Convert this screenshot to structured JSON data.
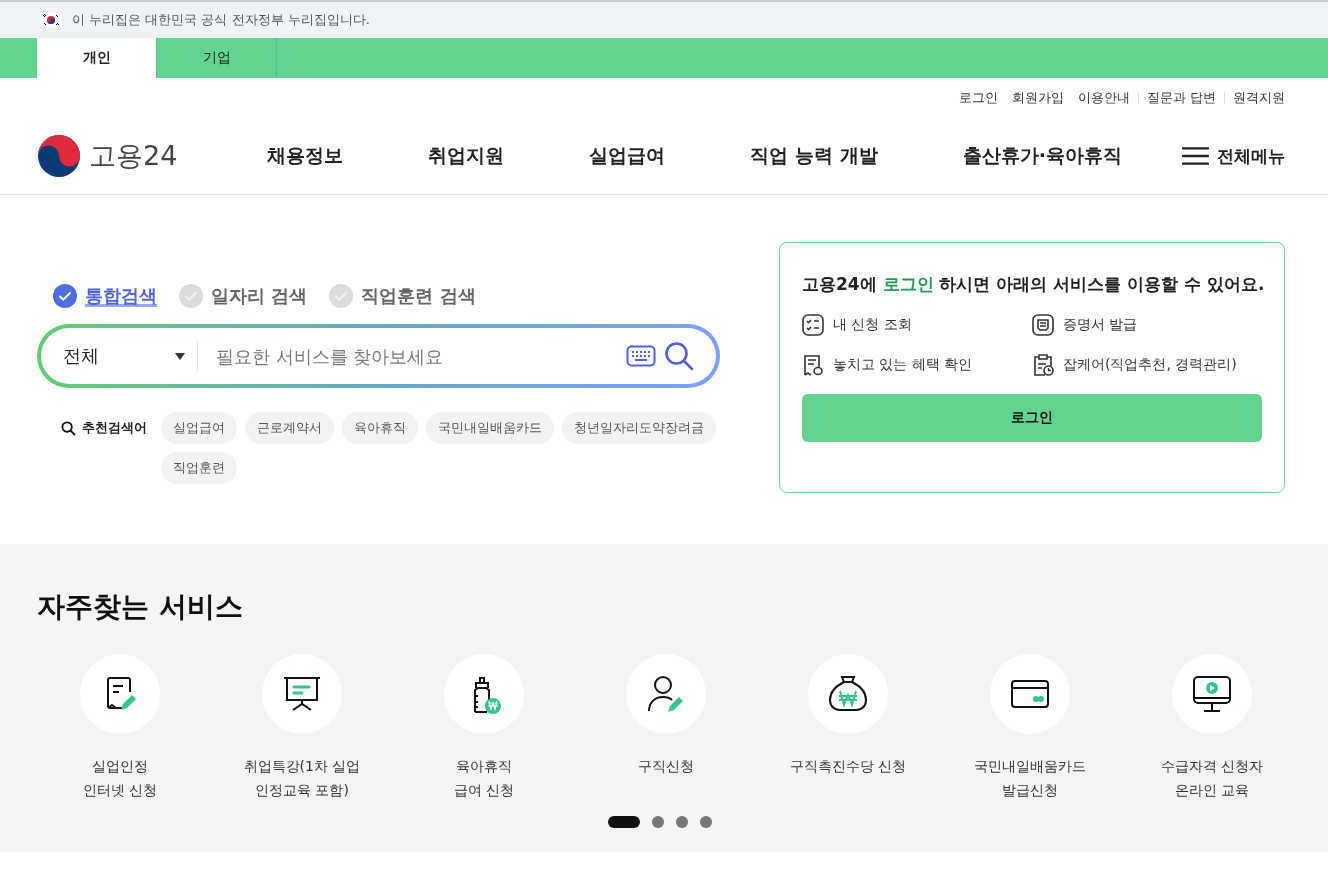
{
  "gov_banner": {
    "text": "이 누리집은 대한민국 공식 전자정부 누리집입니다."
  },
  "audience_tabs": [
    {
      "label": "개인",
      "selected": true
    },
    {
      "label": "기업",
      "selected": false
    }
  ],
  "utility_links": [
    "로그인",
    "회원가입",
    "이용안내",
    "질문과 답변",
    "원격지원"
  ],
  "logo": {
    "text": "고용24"
  },
  "main_nav": [
    "채용정보",
    "취업지원",
    "실업급여",
    "직업 능력 개발",
    "출산휴가·육아휴직"
  ],
  "all_menu": {
    "label": "전체메뉴"
  },
  "search_tabs": [
    {
      "label": "통합검색",
      "selected": true
    },
    {
      "label": "일자리 검색",
      "selected": false
    },
    {
      "label": "직업훈련 검색",
      "selected": false
    }
  ],
  "search": {
    "scope": "전체",
    "placeholder": "필요한 서비스를 찾아보세요"
  },
  "recommended": {
    "label": "추천검색어",
    "keywords": [
      "실업급여",
      "근로계약서",
      "육아휴직",
      "국민내일배움카드",
      "청년일자리도약장려금",
      "직업훈련"
    ]
  },
  "login_card": {
    "heading_before": "고용24에 ",
    "heading_highlight": "로그인",
    "heading_after": " 하시면 아래의 서비스를 이용할 수 있어요.",
    "items": [
      {
        "kind": "checklist",
        "label": "내 신청 조회"
      },
      {
        "kind": "certificate",
        "label": "증명서 발급"
      },
      {
        "kind": "receipt",
        "label": "놓치고 있는 혜택 확인"
      },
      {
        "kind": "clipboard",
        "label": "잡케어(직업추천, 경력관리)"
      }
    ],
    "button": "로그인"
  },
  "frequent_services": {
    "title": "자주찾는 서비스",
    "items": [
      {
        "kind": "document-pen",
        "lines": [
          "실업인정",
          "인터넷 신청"
        ]
      },
      {
        "kind": "presentation",
        "lines": [
          "취업특강(1차 실업",
          "인정교육 포함)"
        ]
      },
      {
        "kind": "bottle",
        "lines": [
          "육아휴직",
          "급여 신청"
        ]
      },
      {
        "kind": "person-pen",
        "lines": [
          "구직신청"
        ]
      },
      {
        "kind": "money-bag",
        "lines": [
          "구직촉진수당 신청"
        ]
      },
      {
        "kind": "card",
        "lines": [
          "국민내일배움카드",
          "발급신청"
        ]
      },
      {
        "kind": "monitor",
        "lines": [
          "수급자격 신청자",
          "온라인 교육"
        ]
      }
    ],
    "pages": [
      {
        "selected": true
      },
      {
        "selected": false
      },
      {
        "selected": false
      },
      {
        "selected": false
      }
    ]
  }
}
